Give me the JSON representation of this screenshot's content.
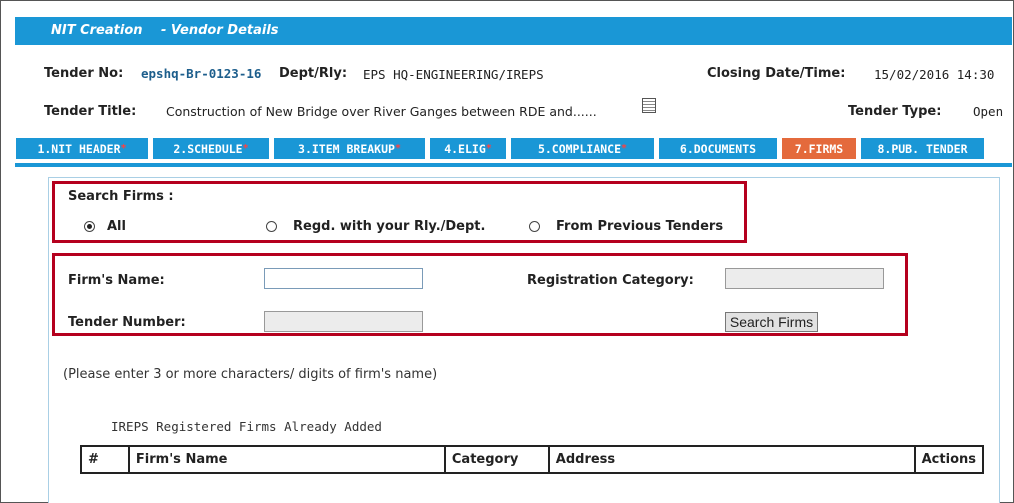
{
  "window": {
    "section": "NIT Creation",
    "subsection": "- Vendor Details"
  },
  "tender": {
    "no_label": "Tender No:",
    "no_value": "epshq-Br-0123-16",
    "dept_label": "Dept/Rly:",
    "dept_value": "EPS HQ-ENGINEERING/IREPS",
    "closing_label": "Closing Date/Time:",
    "closing_value": "15/02/2016 14:30",
    "title_label": "Tender Title:",
    "title_value": "Construction of New Bridge over River Ganges between RDE and......",
    "type_label": "Tender Type:",
    "type_value": "Open"
  },
  "tabs": [
    {
      "label": "1.NIT HEADER",
      "required": "*"
    },
    {
      "label": "2.SCHEDULE",
      "required": "*"
    },
    {
      "label": "3.ITEM BREAKUP",
      "required": "*"
    },
    {
      "label": "4.ELIG",
      "required": "*"
    },
    {
      "label": "5.COMPLIANCE",
      "required": "*"
    },
    {
      "label": "6.DOCUMENTS",
      "required": ""
    },
    {
      "label": "7.FIRMS",
      "required": ""
    },
    {
      "label": "8.PUB. TENDER",
      "required": ""
    }
  ],
  "active_tab": "7.FIRMS",
  "search": {
    "title": "Search Firms :",
    "options": [
      "All",
      "Regd. with your Rly./Dept.",
      "From Previous Tenders"
    ],
    "selected": "All"
  },
  "form": {
    "firm_name_label": "Firm's Name:",
    "firm_name_value": "",
    "reg_category_label": "Registration Category:",
    "reg_category_value": "",
    "tender_number_label": "Tender Number:",
    "tender_number_value": "",
    "search_button": "Search Firms"
  },
  "note": "(Please enter 3 or more characters/ digits of firm's name)",
  "added_firms": {
    "heading": "IREPS Registered Firms Already Added",
    "columns": [
      "#",
      "Firm's Name",
      "Category",
      "Address",
      "Actions"
    ]
  },
  "colors": {
    "accent": "#1a97d6",
    "active_tab": "#e46a3c",
    "highlight_box": "#b5001e"
  }
}
